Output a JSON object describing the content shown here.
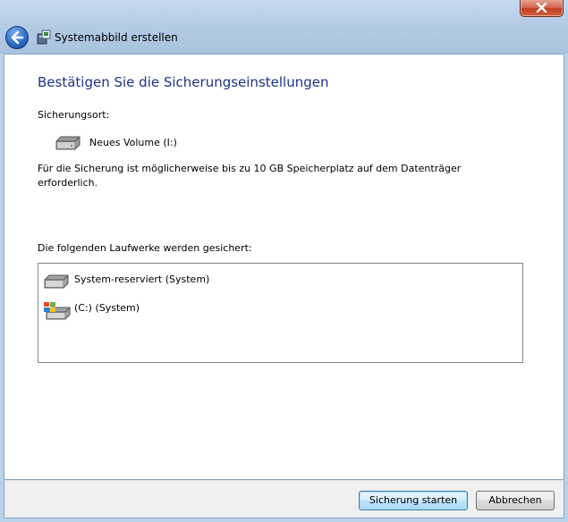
{
  "window": {
    "title": "Systemabbild erstellen",
    "close_icon": "close-icon",
    "back_icon": "back-arrow-icon"
  },
  "main": {
    "heading": "Bestätigen Sie die Sicherungseinstellungen",
    "location_label": "Sicherungsort:",
    "location_drive": {
      "name": "Neues Volume (I:)",
      "icon": "hard-drive-icon"
    },
    "description_line1": "Für die Sicherung ist möglicherweise bis zu 10 GB Speicherplatz auf dem Datenträger",
    "description_line2": "erforderlich.",
    "drives_label": "Die folgenden Laufwerke werden gesichert:",
    "drives": [
      {
        "name": "System-reserviert (System)",
        "icon": "hard-drive-icon"
      },
      {
        "name": "(C:) (System)",
        "icon": "windows-drive-icon"
      }
    ]
  },
  "footer": {
    "start_label": "Sicherung starten",
    "cancel_label": "Abbrechen"
  },
  "colors": {
    "heading": "#1e3287",
    "frame": "#b9d1ea",
    "close_button": "#c13e24"
  }
}
